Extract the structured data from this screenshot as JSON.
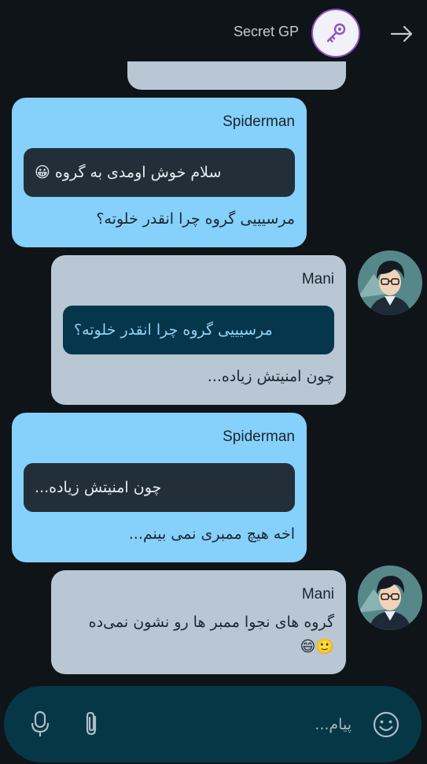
{
  "header": {
    "title": "Secret GP",
    "back_icon": "arrow-right-icon",
    "avatar_icon": "key-icon"
  },
  "messages": [
    {
      "sender": "Spiderman",
      "quote": "سلام خوش اومدی به گروه 😀",
      "text": "مرسیییی گروه چرا انقدر خلوته؟"
    },
    {
      "sender": "Mani",
      "quote": "مرسیییی گروه چرا انقدر خلوته؟",
      "text": "چون امنیتش زیاده..."
    },
    {
      "sender": "Spiderman",
      "quote": "چون امنیتش زیاده...",
      "text": "اخه هیچ ممبری نمی بینم..."
    },
    {
      "sender": "Mani",
      "text_line1": "گروه های نجوا ممبر ها رو نشون نمی‌ده",
      "text_line2": "🙂😄"
    }
  ],
  "composer": {
    "placeholder": "پیام...",
    "emoji_icon": "smiley-icon",
    "attach_icon": "paperclip-icon",
    "mic_icon": "microphone-icon"
  },
  "colors": {
    "background": "#0f1418",
    "bubble_blue": "#86d1fb",
    "bubble_gray": "#b8c7d3",
    "composer": "#053747",
    "accent_purple": "#8e55c7"
  }
}
